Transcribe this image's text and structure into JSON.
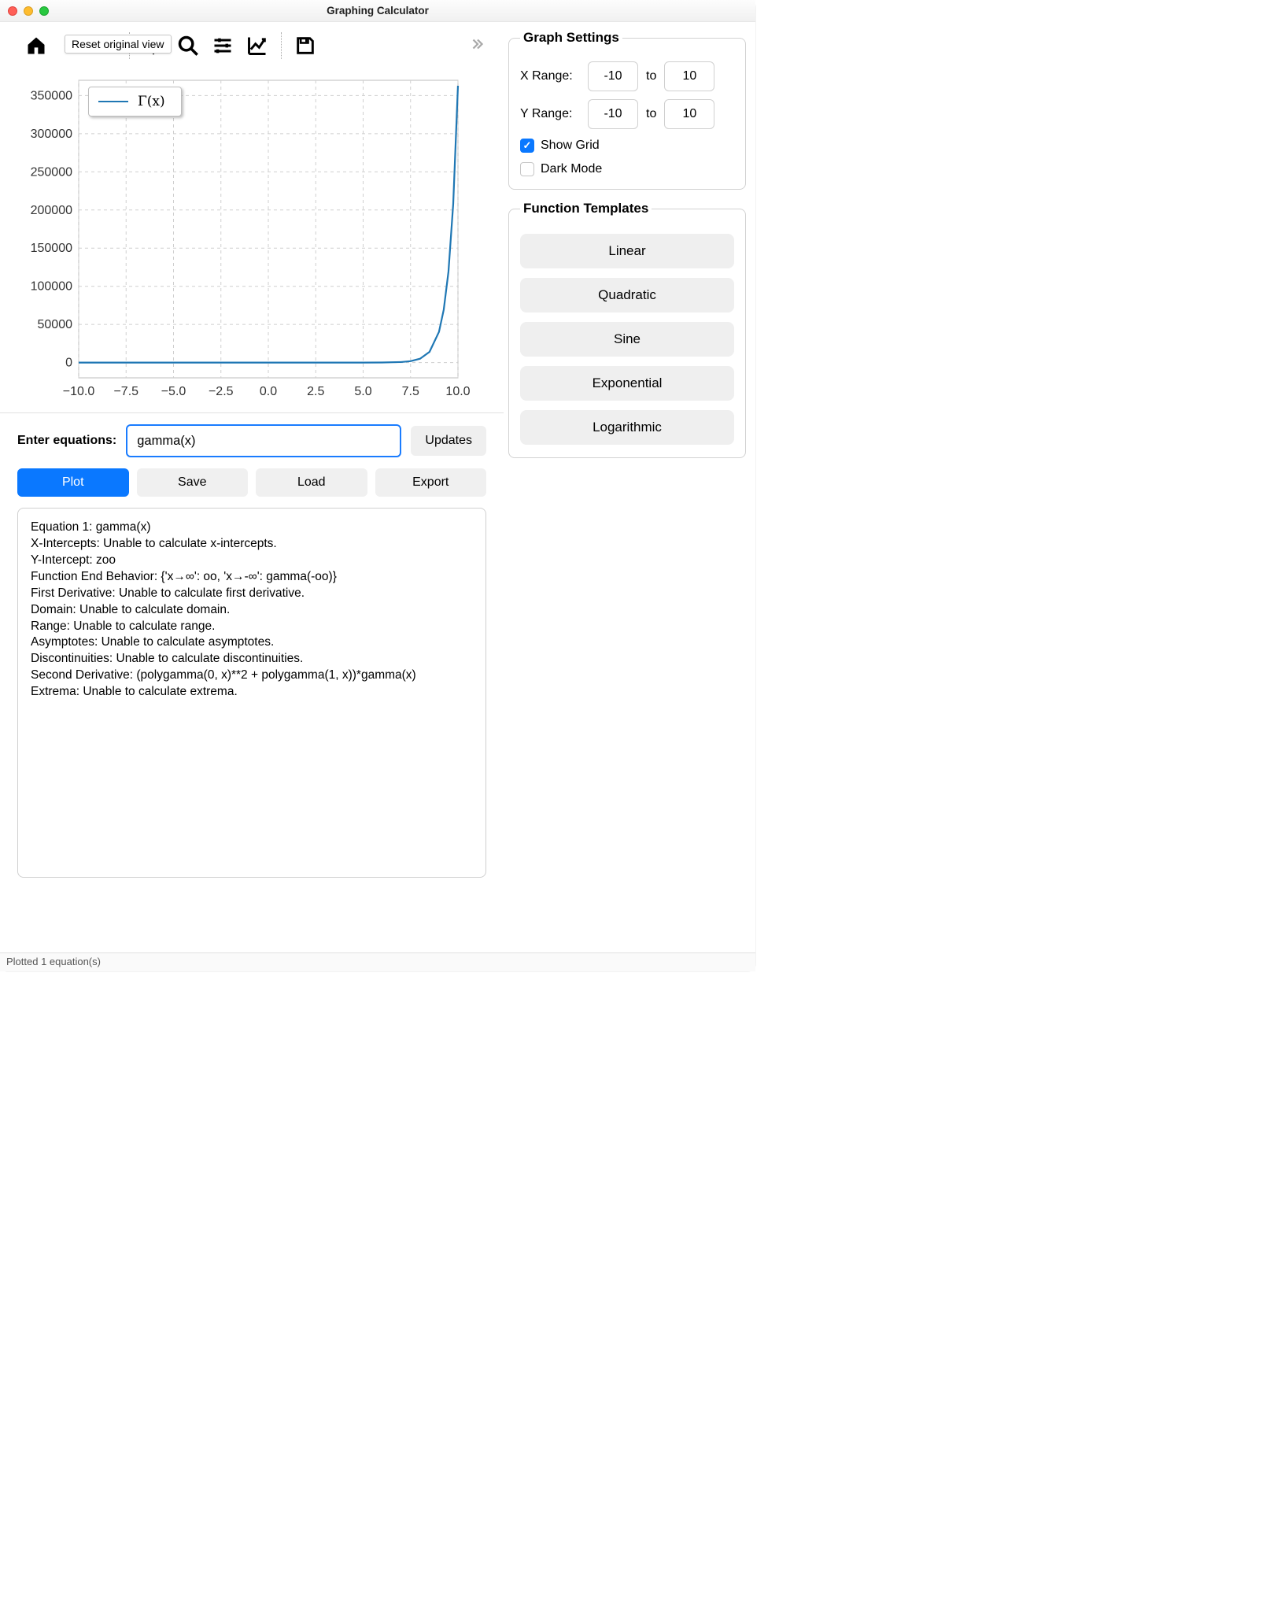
{
  "window": {
    "title": "Graphing Calculator"
  },
  "toolbar": {
    "tooltip": "Reset original view"
  },
  "chart_data": {
    "type": "line",
    "title": "",
    "xlabel": "",
    "ylabel": "",
    "x_ticks": [
      -10.0,
      -7.5,
      -5.0,
      -2.5,
      0.0,
      2.5,
      5.0,
      7.5,
      10.0
    ],
    "y_ticks": [
      0,
      50000,
      100000,
      150000,
      200000,
      250000,
      300000,
      350000
    ],
    "xlim": [
      -10,
      10
    ],
    "ylim": [
      -20000,
      370000
    ],
    "grid": true,
    "legend": {
      "position": "upper left",
      "entries": [
        "Γ(x)"
      ]
    },
    "series": [
      {
        "name": "Γ(x)",
        "color": "#1f77b4",
        "x": [
          -10,
          -9,
          -8,
          -7,
          -6,
          -5,
          -4,
          -3,
          -2,
          -1,
          0,
          1,
          2,
          3,
          4,
          5,
          6,
          7,
          7.5,
          8,
          8.5,
          9,
          9.25,
          9.5,
          9.75,
          10
        ],
        "values": [
          0,
          0,
          0,
          0,
          0,
          0,
          0,
          0,
          0,
          0,
          0,
          1,
          1,
          2,
          6,
          24,
          120,
          720,
          1871,
          5040,
          14034,
          40320,
          69300,
          119292,
          208000,
          362880
        ]
      }
    ]
  },
  "equation": {
    "label": "Enter equations:",
    "value": "gamma(x)",
    "updates_btn": "Updates"
  },
  "actions": {
    "plot": "Plot",
    "save": "Save",
    "load": "Load",
    "export": "Export"
  },
  "output_text": "Equation 1: gamma(x)\nX-Intercepts: Unable to calculate x-intercepts.\nY-Intercept: zoo\nFunction End Behavior: {'x→∞': oo, 'x→-∞': gamma(-oo)}\nFirst Derivative: Unable to calculate first derivative.\nDomain: Unable to calculate domain.\nRange: Unable to calculate range.\nAsymptotes: Unable to calculate asymptotes.\nDiscontinuities: Unable to calculate discontinuities.\nSecond Derivative: (polygamma(0, x)**2 + polygamma(1, x))*gamma(x)\nExtrema: Unable to calculate extrema.",
  "settings": {
    "title": "Graph Settings",
    "xrange_label": "X Range:",
    "yrange_label": "Y Range:",
    "to": "to",
    "xmin": "-10",
    "xmax": "10",
    "ymin": "-10",
    "ymax": "10",
    "show_grid_label": "Show Grid",
    "dark_mode_label": "Dark Mode",
    "show_grid_checked": true,
    "dark_mode_checked": false
  },
  "templates": {
    "title": "Function Templates",
    "items": [
      "Linear",
      "Quadratic",
      "Sine",
      "Exponential",
      "Logarithmic"
    ]
  },
  "status": "Plotted 1 equation(s)"
}
